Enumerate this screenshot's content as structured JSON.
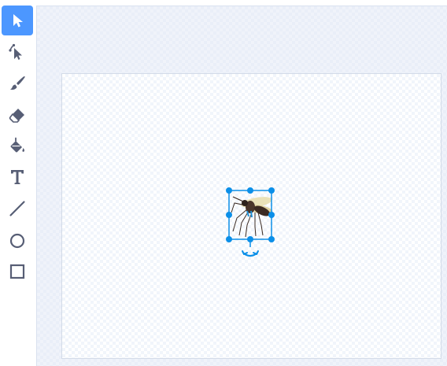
{
  "toolbar": {
    "tools": [
      {
        "name": "select",
        "icon": "arrow-pointer-icon",
        "active": true
      },
      {
        "name": "reshape",
        "icon": "reshape-pointer-icon",
        "active": false
      },
      {
        "name": "brush",
        "icon": "brush-icon",
        "active": false
      },
      {
        "name": "eraser",
        "icon": "eraser-icon",
        "active": false
      },
      {
        "name": "fill",
        "icon": "paint-bucket-icon",
        "active": false
      },
      {
        "name": "text",
        "icon": "text-icon",
        "active": false,
        "glyph": "T"
      },
      {
        "name": "line",
        "icon": "line-icon",
        "active": false
      },
      {
        "name": "circle",
        "icon": "circle-icon",
        "active": false
      },
      {
        "name": "rectangle",
        "icon": "rectangle-icon",
        "active": false
      }
    ]
  },
  "colors": {
    "accent": "#4c97ff",
    "selection": "#0b8fe8",
    "icon": "#575e75"
  },
  "canvas": {
    "sprite": "mosquito"
  }
}
